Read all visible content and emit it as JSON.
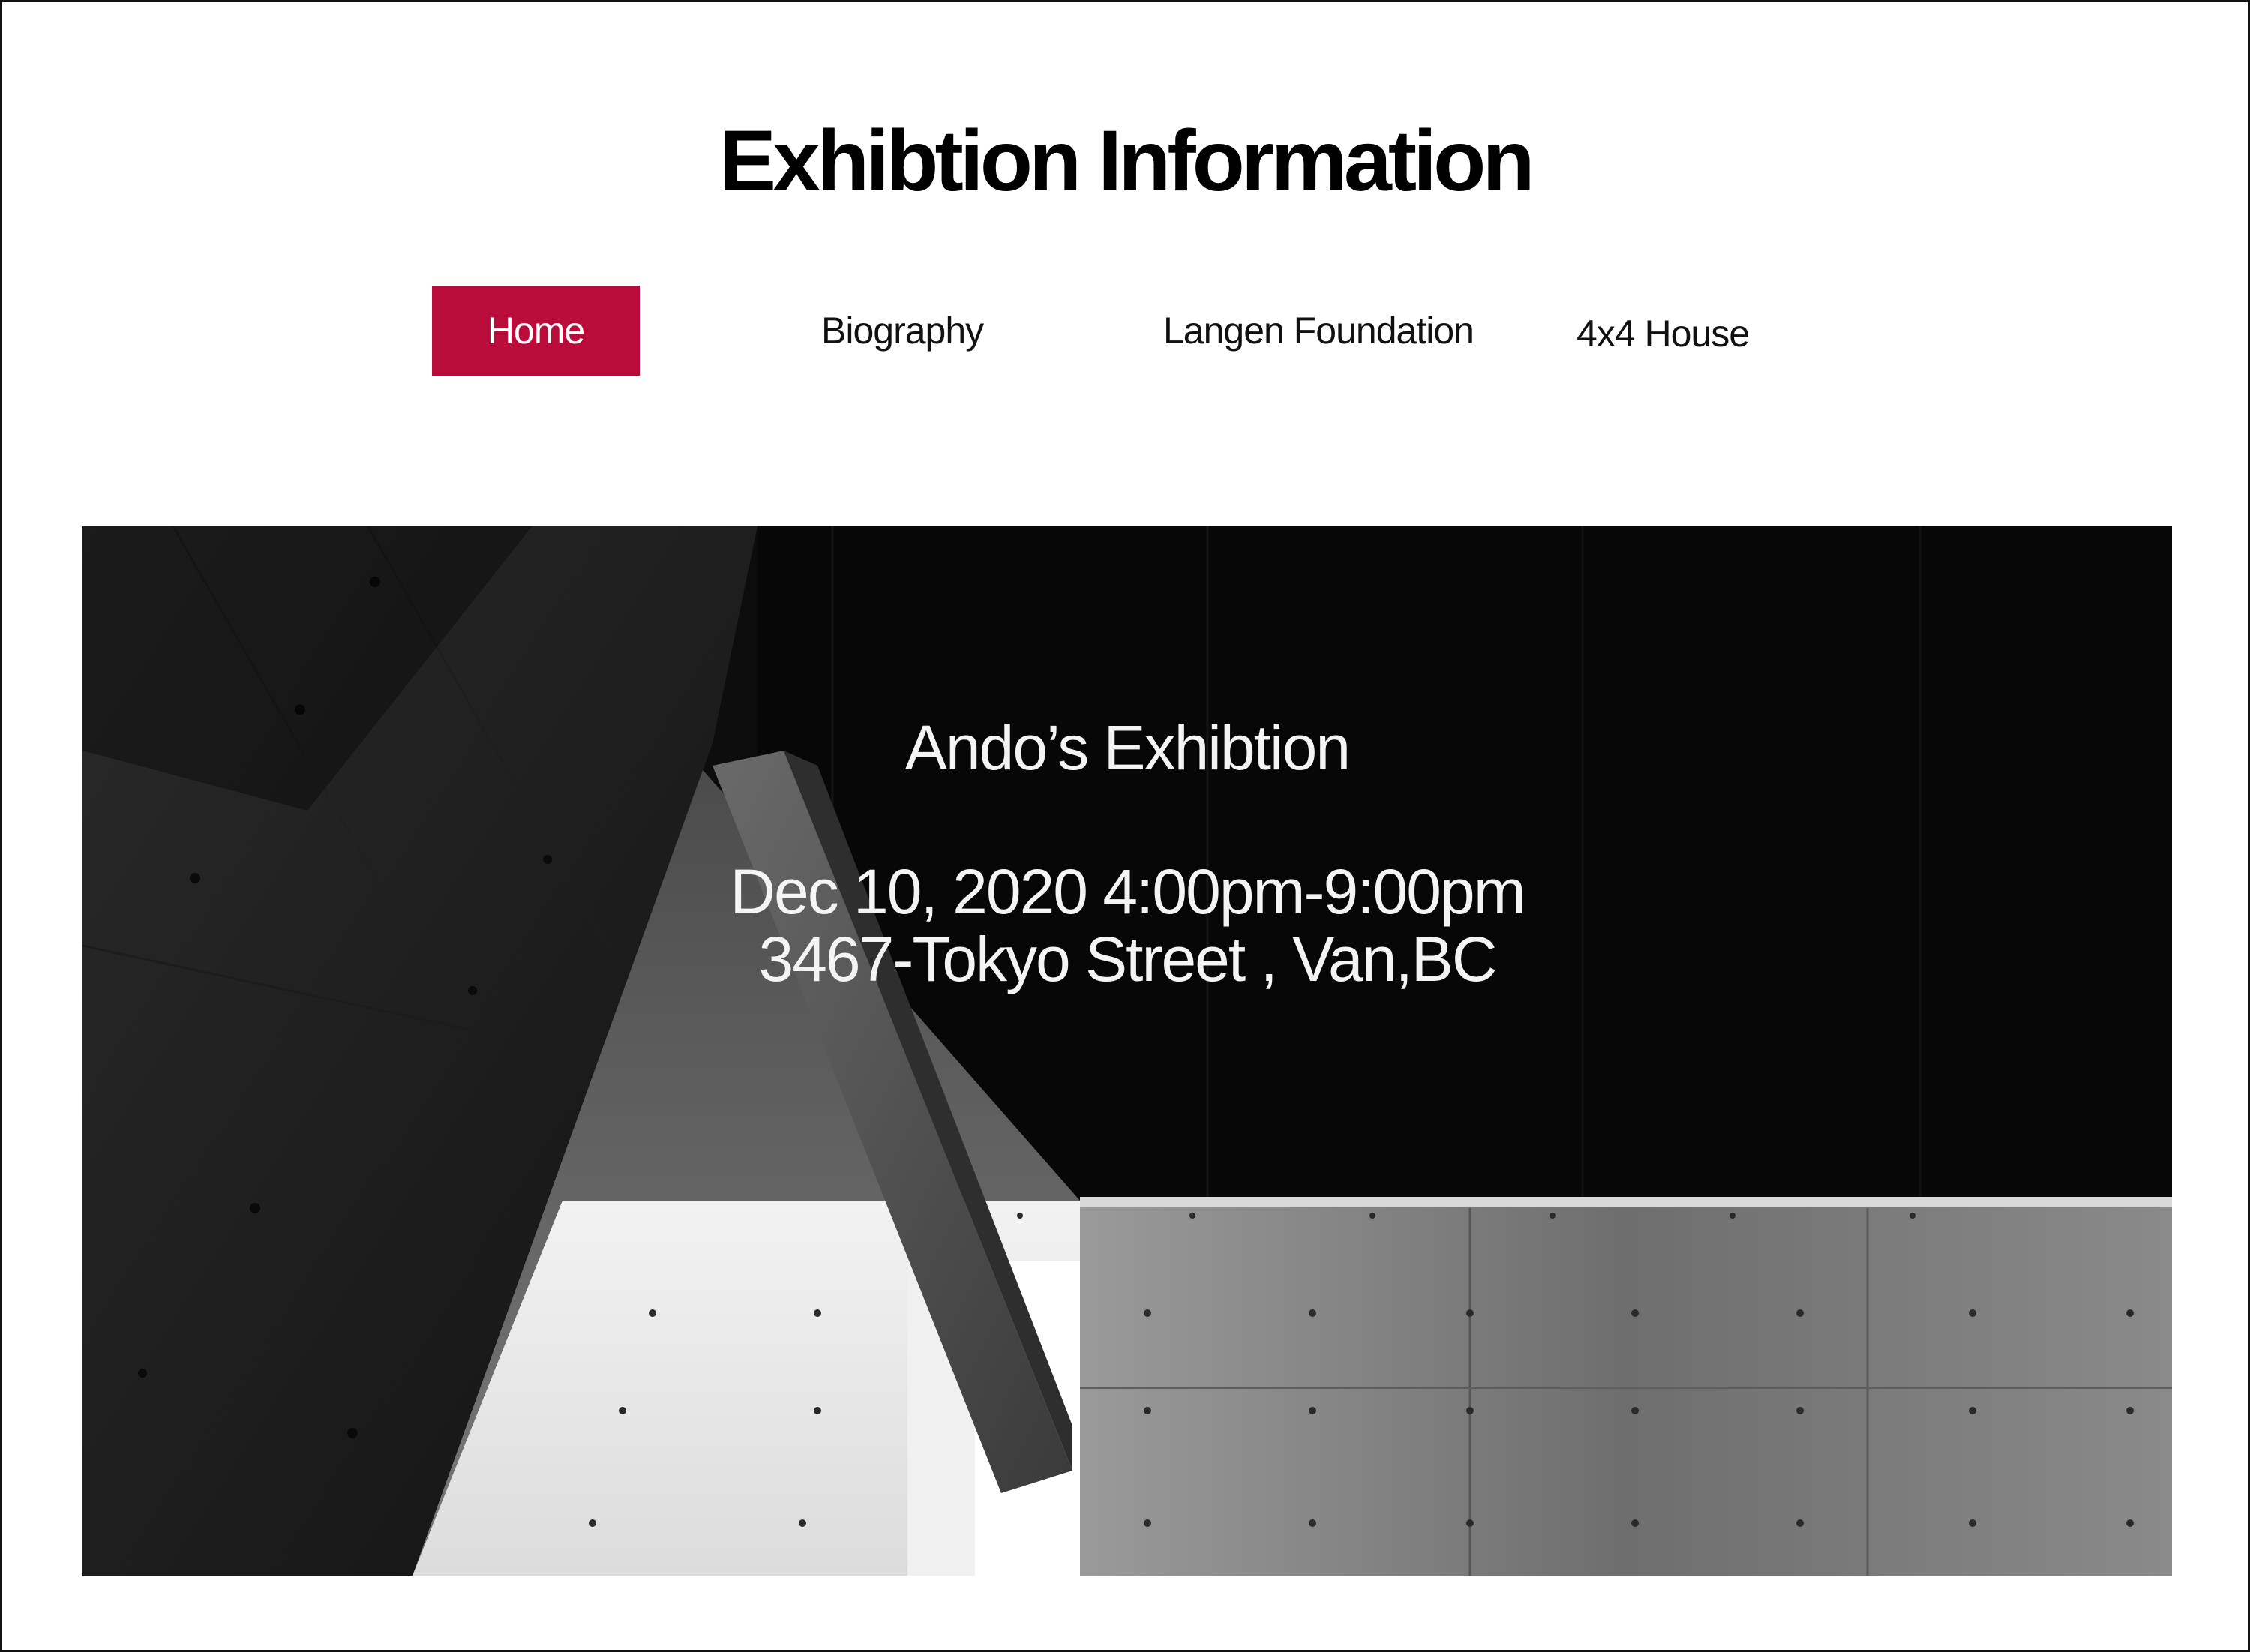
{
  "header": {
    "title": "Exhibtion Information"
  },
  "nav": {
    "items": [
      {
        "label": "Home",
        "active": true
      },
      {
        "label": "Biography",
        "active": false
      },
      {
        "label": "Langen Foundation",
        "active": false
      },
      {
        "label": "4x4 House",
        "active": false
      }
    ]
  },
  "hero": {
    "title": "Ando’s Exhibtion",
    "datetime": "Dec 10, 2020 4:00pm-9:00pm",
    "address": "3467-Tokyo Street , Van,BC"
  },
  "colors": {
    "accent": "#BA0C3A",
    "background": "#FFFFFF",
    "text": "#000000",
    "hero_text": "#F4F4F4"
  }
}
